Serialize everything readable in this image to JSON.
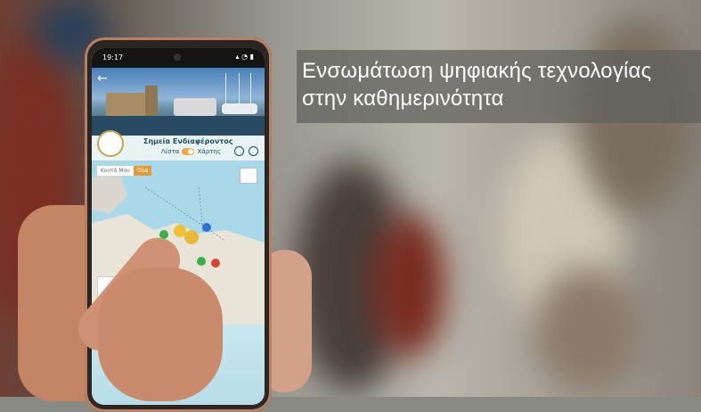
{
  "caption": {
    "line1": "Ενσωμάτωση ψηφιακής τεχνολογίας",
    "line2": "στην καθημερινότητα"
  },
  "phone": {
    "status_time": "19:17",
    "status_icons": "signal-wifi-battery-icons",
    "page_title": "Σημεία Ενδιαφέροντος",
    "toggle_left": "Λίστα",
    "toggle_right": "Χάρτης",
    "filter_left": "Κοντά Μου",
    "filter_right": "Όλα"
  },
  "colors": {
    "caption_bg": "#5f5f5c",
    "toggle_accent": "#f2a93b",
    "map_sea": "#a9d8e8"
  }
}
